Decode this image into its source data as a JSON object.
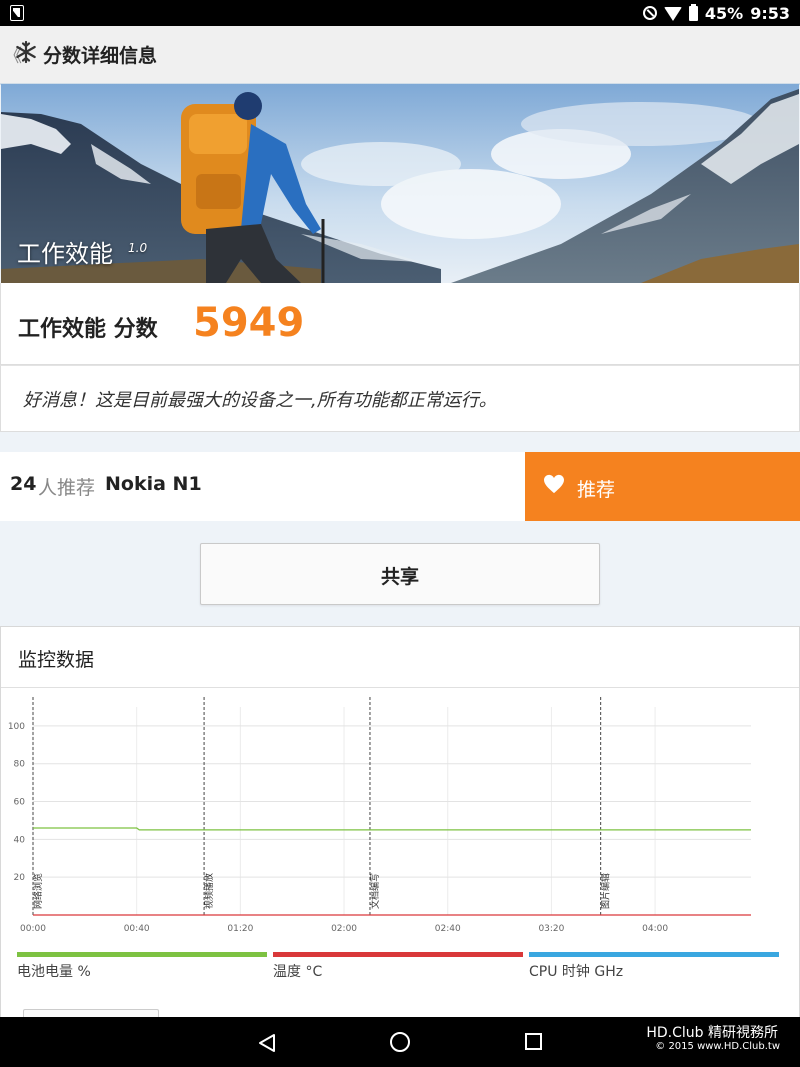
{
  "status_bar": {
    "battery": "45%",
    "time": "9:53"
  },
  "app_bar": {
    "back": "《",
    "title": "分数详细信息"
  },
  "hero": {
    "title": "工作效能",
    "version": "1.0"
  },
  "score": {
    "label": "工作效能 分数",
    "value": "5949"
  },
  "message": "好消息！这是目前最强大的设备之一,所有功能都正常运行。",
  "recommend": {
    "count": "24",
    "people_text": "人推荐",
    "device": "Nokia N1",
    "button_label": "推荐"
  },
  "share": {
    "label": "共享"
  },
  "monitor": {
    "title": "监控数据"
  },
  "chart_data": {
    "type": "line",
    "x_ticks": [
      "00:00",
      "00:40",
      "01:20",
      "02:00",
      "02:40",
      "03:20",
      "04:00"
    ],
    "y_ticks": [
      20,
      40,
      60,
      80,
      100
    ],
    "ylim": [
      0,
      110
    ],
    "xlim_minutes": [
      0,
      277
    ],
    "markers": [
      {
        "label": "网络浏览",
        "time_min": 0
      },
      {
        "label": "视频播放",
        "time_min": 66
      },
      {
        "label": "文档编写",
        "time_min": 130
      },
      {
        "label": "图片编辑",
        "time_min": 219
      }
    ],
    "series": [
      {
        "name": "电池电量 %",
        "color": "#7dc242",
        "points": [
          [
            0,
            46
          ],
          [
            40,
            46
          ],
          [
            41,
            45
          ],
          [
            277,
            45
          ]
        ]
      },
      {
        "name": "温度 °C",
        "color": "#d9383a",
        "points": [
          [
            0,
            0
          ],
          [
            277,
            0
          ]
        ]
      },
      {
        "name": "CPU 时钟 GHz",
        "color": "#3aa7e0",
        "points": []
      }
    ],
    "grid": true,
    "legend_position": "bottom"
  },
  "watermark": {
    "line1": "HD.Club 精研視務所",
    "line2": "© 2015  www.HD.Club.tw"
  },
  "colors": {
    "accent": "#f5821f",
    "battery": "#7dc242",
    "temperature": "#d9383a",
    "cpu": "#3aa7e0"
  }
}
